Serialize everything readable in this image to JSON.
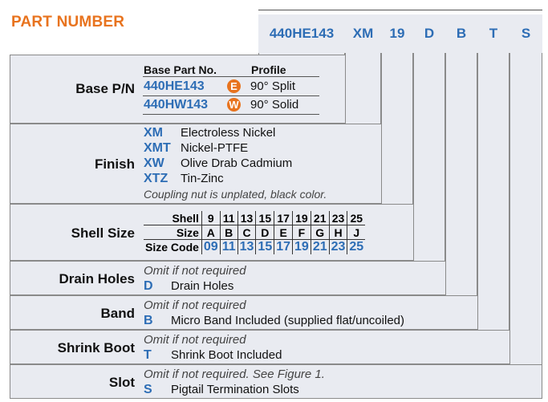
{
  "title": "PART NUMBER",
  "header": {
    "base": "440HE143",
    "finish": "XM",
    "shell": "19",
    "drain": "D",
    "band": "B",
    "boot": "T",
    "slot": "S"
  },
  "base_pn": {
    "label": "Base P/N",
    "col1": "Base Part No.",
    "col2": "Profile",
    "rows": [
      {
        "part": "440HE143",
        "code": "E",
        "profile": "90° Split"
      },
      {
        "part": "440HW143",
        "code": "W",
        "profile": "90° Solid"
      }
    ]
  },
  "finish": {
    "label": "Finish",
    "items": [
      {
        "code": "XM",
        "desc": "Electroless Nickel"
      },
      {
        "code": "XMT",
        "desc": "Nickel-PTFE"
      },
      {
        "code": "XW",
        "desc": "Olive Drab Cadmium"
      },
      {
        "code": "XTZ",
        "desc": "Tin-Zinc"
      }
    ],
    "note": "Coupling nut is unplated, black color."
  },
  "shell_size": {
    "label": "Shell Size",
    "row_labels": [
      "Shell",
      "Size",
      "Size Code"
    ],
    "shell": [
      "9",
      "11",
      "13",
      "15",
      "17",
      "19",
      "21",
      "23",
      "25"
    ],
    "size": [
      "A",
      "B",
      "C",
      "D",
      "E",
      "F",
      "G",
      "H",
      "J"
    ],
    "code": [
      "09",
      "11",
      "13",
      "15",
      "17",
      "19",
      "21",
      "23",
      "25"
    ]
  },
  "drain": {
    "label": "Drain Holes",
    "note": "Omit if not required",
    "code": "D",
    "desc": "Drain Holes"
  },
  "band": {
    "label": "Band",
    "note": "Omit if not required",
    "code": "B",
    "desc": "Micro Band Included (supplied flat/uncoiled)"
  },
  "boot": {
    "label": "Shrink Boot",
    "note": "Omit if not required",
    "code": "T",
    "desc": "Shrink Boot Included"
  },
  "slot": {
    "label": "Slot",
    "note": "Omit if not required. See Figure 1.",
    "code": "S",
    "desc": "Pigtail Termination Slots"
  }
}
